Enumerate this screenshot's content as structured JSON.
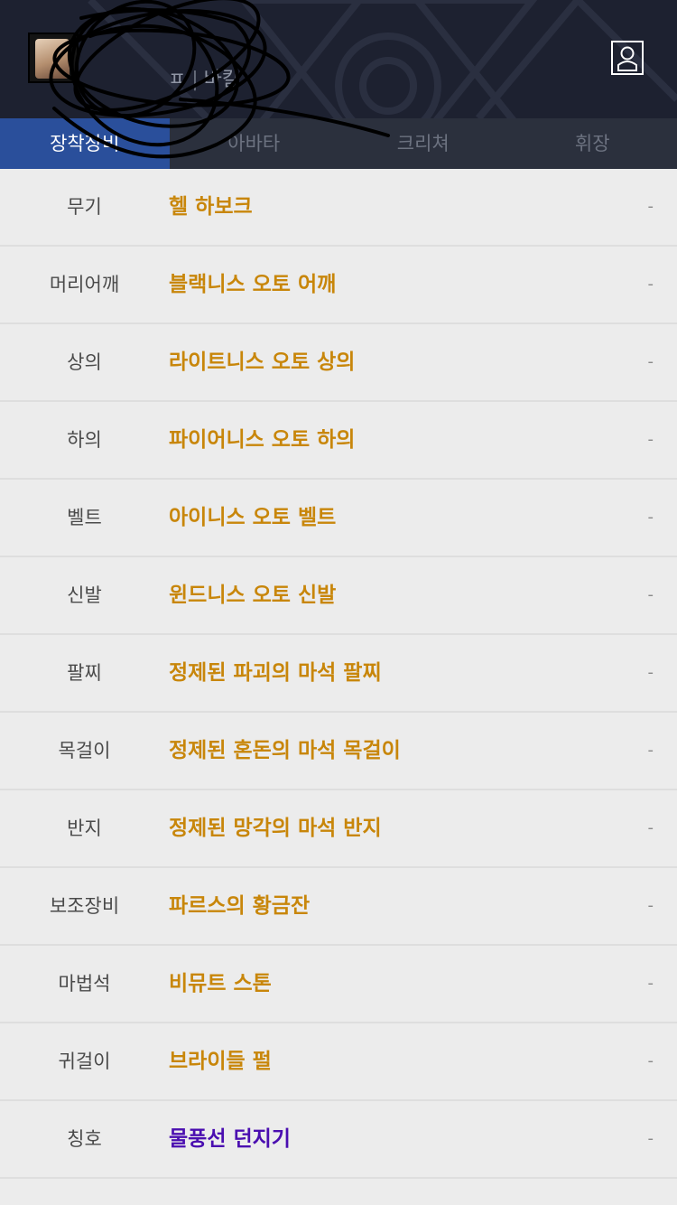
{
  "header": {
    "character_name": "",
    "job_partial": "ㅍ",
    "server": "바칼",
    "profile_icon": "person-icon"
  },
  "tabs": [
    {
      "label": "장착장비",
      "active": true
    },
    {
      "label": "아바타",
      "active": false
    },
    {
      "label": "크리쳐",
      "active": false
    },
    {
      "label": "휘장",
      "active": false
    }
  ],
  "equipment": [
    {
      "slot": "무기",
      "item": "헬 하보크",
      "status": "-",
      "color": "#c8860a"
    },
    {
      "slot": "머리어깨",
      "item": "블랙니스 오토 어깨",
      "status": "-",
      "color": "#c8860a"
    },
    {
      "slot": "상의",
      "item": "라이트니스 오토 상의",
      "status": "-",
      "color": "#c8860a"
    },
    {
      "slot": "하의",
      "item": "파이어니스 오토 하의",
      "status": "-",
      "color": "#c8860a"
    },
    {
      "slot": "벨트",
      "item": "아이니스 오토 벨트",
      "status": "-",
      "color": "#c8860a"
    },
    {
      "slot": "신발",
      "item": "윈드니스 오토 신발",
      "status": "-",
      "color": "#c8860a"
    },
    {
      "slot": "팔찌",
      "item": "정제된 파괴의 마석 팔찌",
      "status": "-",
      "color": "#c8860a"
    },
    {
      "slot": "목걸이",
      "item": "정제된 혼돈의 마석 목걸이",
      "status": "-",
      "color": "#c8860a"
    },
    {
      "slot": "반지",
      "item": "정제된 망각의 마석 반지",
      "status": "-",
      "color": "#c8860a"
    },
    {
      "slot": "보조장비",
      "item": "파르스의 황금잔",
      "status": "-",
      "color": "#c8860a"
    },
    {
      "slot": "마법석",
      "item": "비뮤트 스톤",
      "status": "-",
      "color": "#c8860a"
    },
    {
      "slot": "귀걸이",
      "item": "브라이들 펄",
      "status": "-",
      "color": "#c8860a"
    },
    {
      "slot": "칭호",
      "item": "물풍선 던지기",
      "status": "-",
      "color": "#4a0eb0"
    }
  ]
}
